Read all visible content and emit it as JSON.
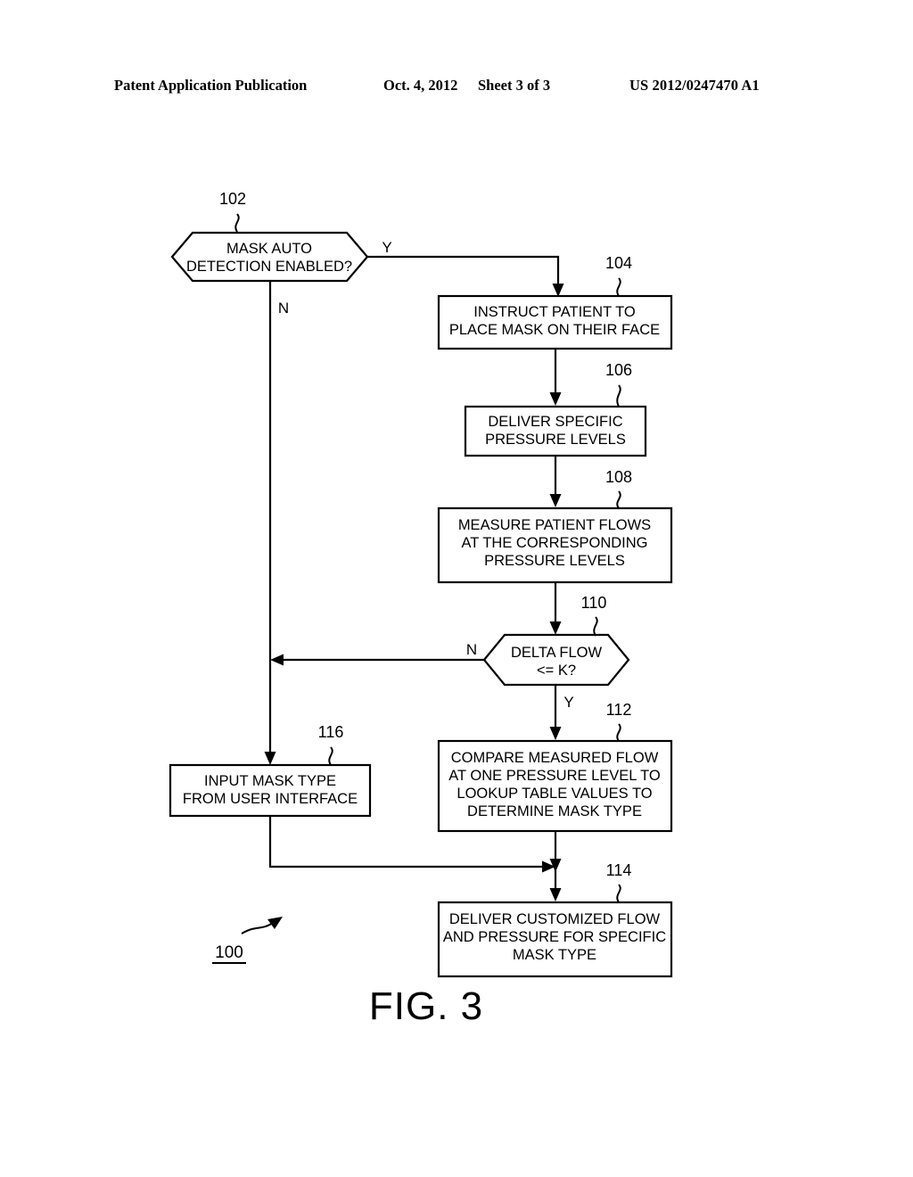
{
  "header": {
    "title": "Patent Application Publication",
    "date": "Oct. 4, 2012",
    "sheet": "Sheet 3 of 3",
    "patent_number": "US 2012/0247470 A1"
  },
  "figure": {
    "caption": "FIG. 3",
    "diagram_ref": "100"
  },
  "nodes": {
    "n102": {
      "ref": "102",
      "shape": "hexagon",
      "lines": [
        "MASK AUTO",
        "DETECTION ENABLED?"
      ]
    },
    "n104": {
      "ref": "104",
      "shape": "rect",
      "lines": [
        "INSTRUCT PATIENT TO",
        "PLACE MASK ON THEIR FACE"
      ]
    },
    "n106": {
      "ref": "106",
      "shape": "rect",
      "lines": [
        "DELIVER SPECIFIC",
        "PRESSURE LEVELS"
      ]
    },
    "n108": {
      "ref": "108",
      "shape": "rect",
      "lines": [
        "MEASURE PATIENT FLOWS",
        "AT THE CORRESPONDING",
        "PRESSURE LEVELS"
      ]
    },
    "n110": {
      "ref": "110",
      "shape": "hexagon",
      "lines": [
        "DELTA FLOW",
        "<= K?"
      ]
    },
    "n112": {
      "ref": "112",
      "shape": "rect",
      "lines": [
        "COMPARE MEASURED FLOW",
        "AT ONE PRESSURE LEVEL TO",
        "LOOKUP TABLE VALUES TO",
        "DETERMINE MASK TYPE"
      ]
    },
    "n114": {
      "ref": "114",
      "shape": "rect",
      "lines": [
        "DELIVER CUSTOMIZED FLOW",
        "AND PRESSURE FOR SPECIFIC",
        "MASK TYPE"
      ]
    },
    "n116": {
      "ref": "116",
      "shape": "rect",
      "lines": [
        "INPUT MASK TYPE",
        "FROM USER INTERFACE"
      ]
    }
  },
  "branches": {
    "b102_yes": "Y",
    "b102_no": "N",
    "b110_no": "N",
    "b110_yes": "Y"
  }
}
